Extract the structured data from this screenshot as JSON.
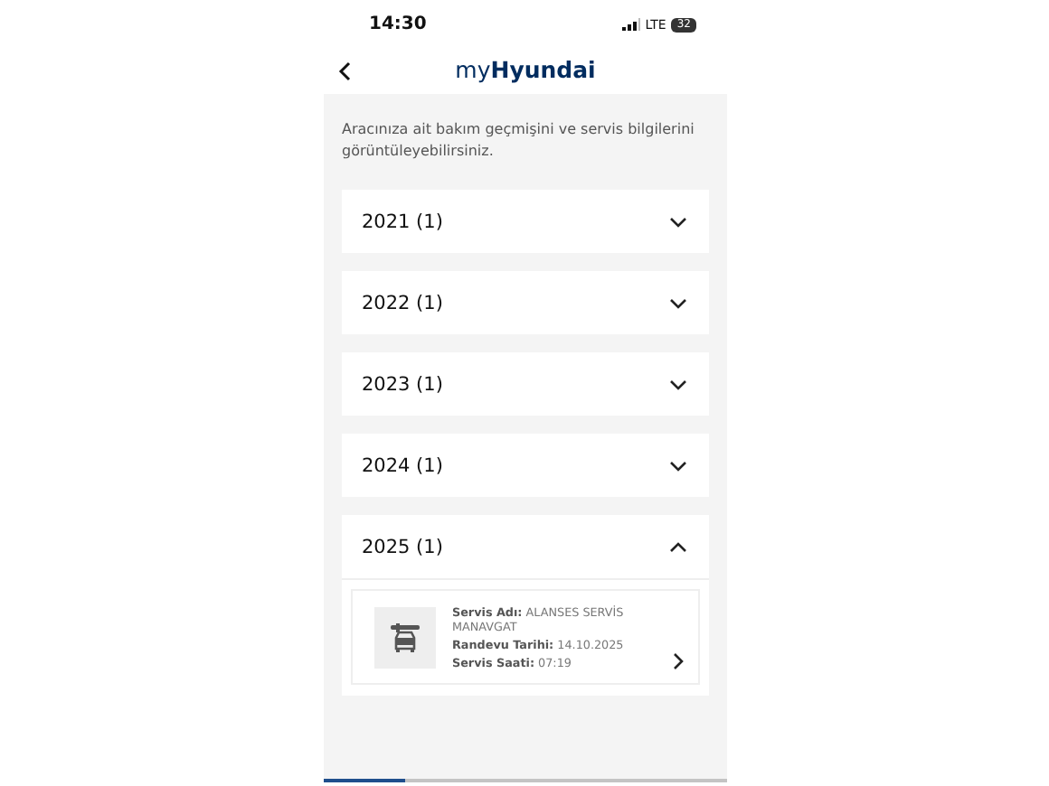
{
  "status_bar": {
    "time": "14:30",
    "network": "LTE",
    "battery": "32"
  },
  "header": {
    "title": "my**Hyundai**"
  },
  "intro": "Aracınıza ait bakım geçmişini ve servis bilgilerini görüntüleyebilirsiniz.",
  "years": [
    {
      "label": "2021 (1)",
      "expanded": false
    },
    {
      "label": "2022 (1)",
      "expanded": false
    },
    {
      "label": "2023 (1)",
      "expanded": false
    },
    {
      "label": "2024 (1)",
      "expanded": false
    },
    {
      "label": "2025 (1)",
      "expanded": true,
      "records": [
        {
          "lines": [
            "**Servis Adı:** ALANSES SERVİS MANAVGAT",
            "**Randevu Tarihi:** 14.10.2025",
            "**Servis Saati:** 07:19"
          ]
        }
      ]
    }
  ],
  "bottom_nav": {
    "tabs": [
      {
        "selected": true
      },
      {
        "selected": false
      },
      {
        "selected": false
      },
      {
        "selected": false
      },
      {
        "selected": false
      }
    ]
  }
}
